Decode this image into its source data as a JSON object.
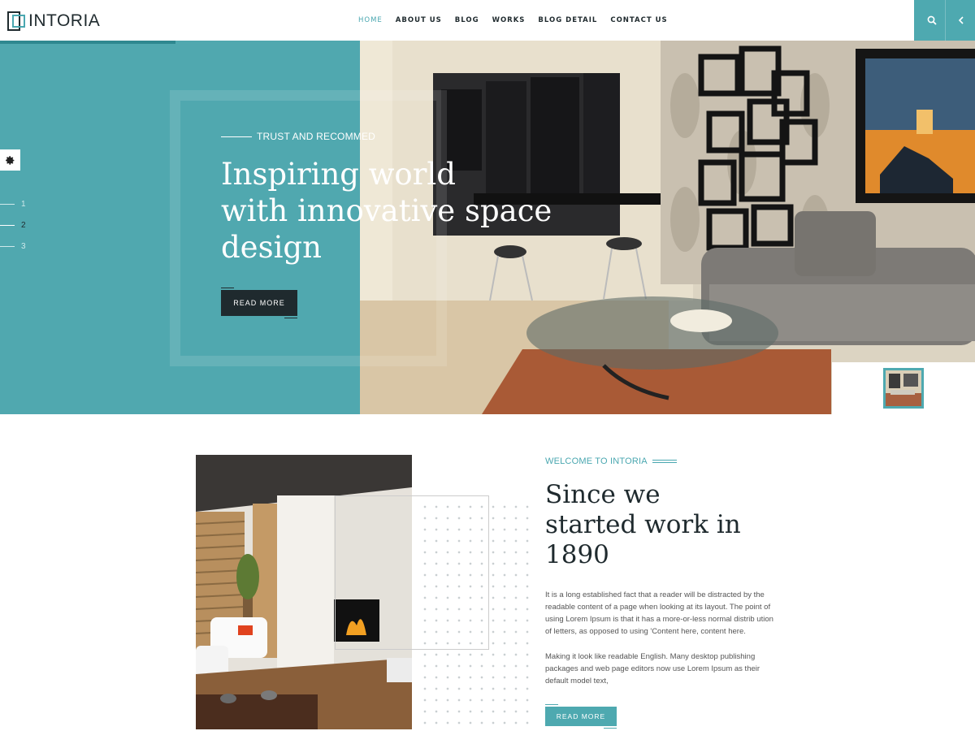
{
  "brand": {
    "name": "INTORIA"
  },
  "nav": {
    "items": [
      {
        "label": "HOME",
        "active": true
      },
      {
        "label": "ABOUT US"
      },
      {
        "label": "BLOG"
      },
      {
        "label": "WORKS"
      },
      {
        "label": "BLOG DETAIL"
      },
      {
        "label": "CONTACT US"
      }
    ]
  },
  "header": {
    "search_icon": "search-icon",
    "back_icon": "chevron-left-icon"
  },
  "hero": {
    "eyebrow": "TRUST AND RECOMMED",
    "title_lines": [
      "Inspiring world",
      "with innovative space",
      "design"
    ],
    "button_label": "READ MORE",
    "pager": [
      "1",
      "2",
      "3"
    ],
    "active_slide": "2"
  },
  "about": {
    "eyebrow": "WELCOME TO INTORIA",
    "title_lines": [
      "Since we",
      "started work in",
      "1890"
    ],
    "paragraph1": "It is a long established fact that a reader will be distracted by the readable content of a page when looking at its layout. The point of using Lorem Ipsum is that it has a more-or-less normal distrib ution of letters, as opposed to using 'Content here, content here.",
    "paragraph2": "Making it look like readable English. Many desktop publishing packages and web page editors now use Lorem Ipsum as their default model text,",
    "button_label": "READ MORE"
  },
  "colors": {
    "accent": "#4ea9b0",
    "dark": "#1f2a2e"
  }
}
